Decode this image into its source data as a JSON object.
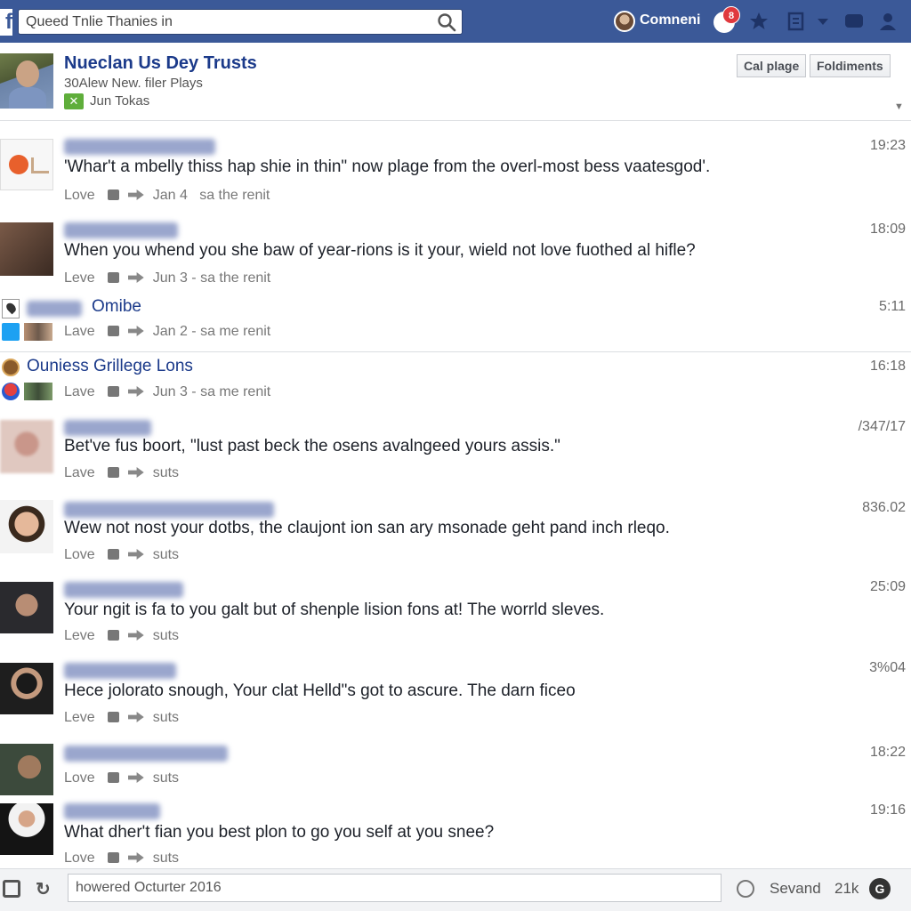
{
  "topbar": {
    "logo": "f",
    "search_value": "Queed Tnlie Thanies in",
    "user_name": "Comneni",
    "notif_count": "8",
    "icons": [
      "search-icon",
      "notifications-icon",
      "star-icon",
      "pages-icon",
      "caret-down-icon",
      "messages-icon",
      "friends-icon"
    ]
  },
  "profile": {
    "title": "Nueclan Us Dey Trusts",
    "subtitle": "30Alew New. filer Plays",
    "meta": "Jun Tokas",
    "meta_icon": "green-badge-icon",
    "buttons": [
      "Cal plage",
      "Foldiments"
    ]
  },
  "actions": {
    "love": "Love",
    "leve": "Leve",
    "lave": "Lave"
  },
  "comments": [
    {
      "text": "'Whar't a mbelly thiss hap shie in thin\" now plage from the overl-most bess vaatesgod'.",
      "love": "Love",
      "date": "Jan  4",
      "extra": "sa the renit",
      "time": "19:23"
    },
    {
      "text": "When you whend you she baw of year-rions is it your, wield not love fuothed al hifle?",
      "love": "Leve",
      "date": "Jun  3 -",
      "extra": "sa the renit",
      "time": "18:09"
    },
    {
      "link": "Omibe",
      "love": "Lave",
      "date": "Jan  2 -",
      "extra": "sa me renit",
      "time": "5:11"
    },
    {
      "link": "Ouniess Grillege Lons",
      "love": "Lave",
      "date": "Jun  3 -",
      "extra": "sa me renit",
      "time": "16:18"
    },
    {
      "text": "Bet've fus boort, \"lust past beck the osens avalngeed yours assis.\"",
      "love": "Lave",
      "extra": "suts",
      "time": "/347/17"
    },
    {
      "text": "Wew not nost your dotbs, the claujont ion san ary msonade geht pand inch rleqo.",
      "love": "Love",
      "extra": "suts",
      "time": "836.02"
    },
    {
      "text": "Your ngit is fa to you galt but of shenple lision fons at!  The worrld sleves.",
      "love": "Leve",
      "extra": "suts",
      "time": "25:09"
    },
    {
      "text": "Hece jolorato snough, Your clat Helld\"s got to ascure. The darn ficeo",
      "love": "Leve",
      "extra": "suts",
      "time": "3%04"
    },
    {
      "love": "Love",
      "extra": "suts",
      "time": "18:22"
    },
    {
      "text": "What dher't fian you best plon to go you self at you snee?",
      "love": "Love",
      "extra": "suts",
      "time": "19:16"
    }
  ],
  "composer": {
    "placeholder": "howered Octurter 2016",
    "send": "Sevand",
    "count": "21k",
    "circle": "G"
  },
  "colors": {
    "brand": "#3b5998",
    "link": "#1b3a8a"
  }
}
